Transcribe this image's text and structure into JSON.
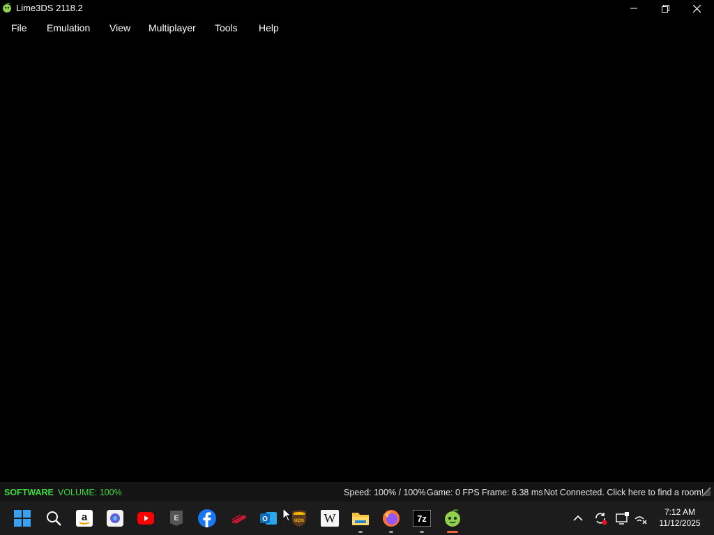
{
  "window": {
    "title": "Lime3DS 2118.2"
  },
  "menu": {
    "items": [
      "File",
      "Emulation",
      "View",
      "Multiplayer",
      "Tools",
      "Help"
    ]
  },
  "status": {
    "renderer": "SOFTWARE",
    "volume": "VOLUME: 100%",
    "speed": "Speed: 100% / 100%",
    "fps": "Game: 0 FPS",
    "frame": "Frame: 6.38 ms",
    "network": "Not Connected. Click here to find a room!"
  },
  "taskbar": {
    "apps": [
      "start-icon",
      "search-icon",
      "amazon-icon",
      "copilot-icon",
      "youtube-icon",
      "epic-games-icon",
      "facebook-icon",
      "bank-of-america-icon",
      "outlook-icon",
      "ups-icon",
      "wikipedia-icon",
      "file-explorer-icon",
      "firefox-icon",
      "7zip-icon",
      "lime3ds-icon"
    ],
    "tray": [
      "show-hidden-icons-chevron",
      "sync-icon",
      "display-icon",
      "network-icon"
    ]
  },
  "clock": {
    "time": "7:12 AM",
    "date": "11/12/2025"
  },
  "colors": {
    "status_accent": "#3ddc3d",
    "active_indicator": "#f0643c"
  }
}
